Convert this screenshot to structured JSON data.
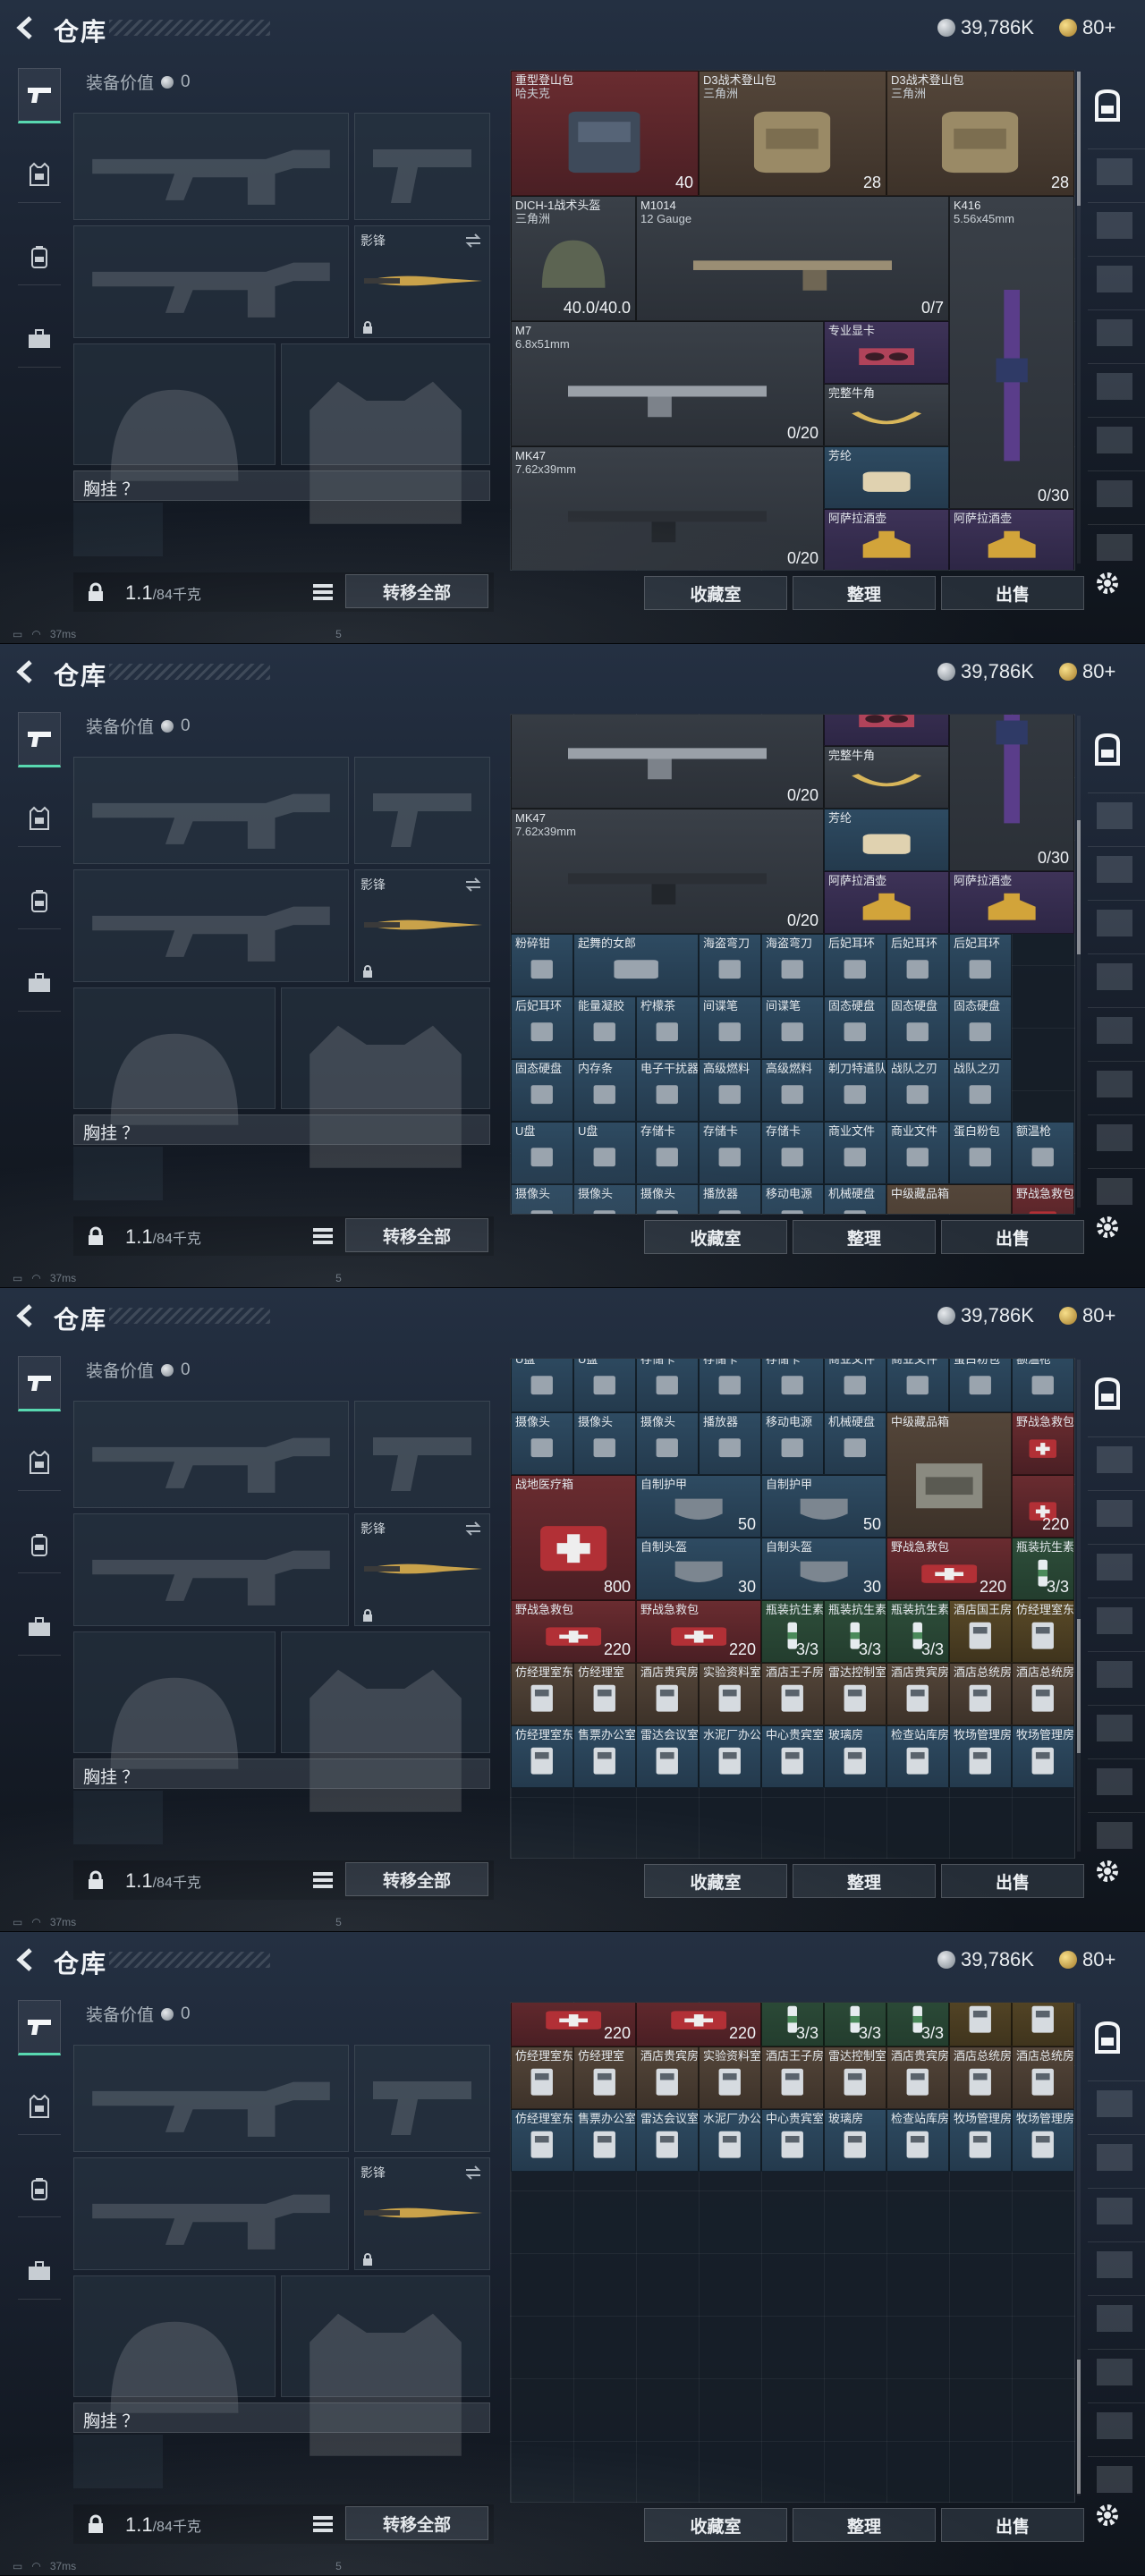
{
  "header": {
    "title": "仓库",
    "silver": "39,786K",
    "gold": "80+"
  },
  "equipment": {
    "value_label": "装备价值",
    "value": "0",
    "melee_label": "影锋",
    "chest_label": "胸挂 ？",
    "weight": "1.1",
    "capacity": "/84千克",
    "transfer_all": "转移全部"
  },
  "actions": {
    "collection": "收藏室",
    "organize": "整理",
    "sell": "出售"
  },
  "status": {
    "ping": "37ms",
    "page": "5"
  },
  "storage_items": [
    {
      "col": 0,
      "row": 0,
      "w": 3,
      "h": 2,
      "bg": "c-red",
      "name": "重型登山包",
      "sub": "哈夫克",
      "qty": "40",
      "icon": "heavy-backpack"
    },
    {
      "col": 3,
      "row": 0,
      "w": 3,
      "h": 2,
      "bg": "c-brown",
      "name": "D3战术登山包",
      "sub": "三角洲",
      "qty": "28",
      "icon": "tactical-backpack"
    },
    {
      "col": 6,
      "row": 0,
      "w": 3,
      "h": 2,
      "bg": "c-brown",
      "name": "D3战术登山包",
      "sub": "三角洲",
      "qty": "28",
      "icon": "tactical-backpack"
    },
    {
      "col": 0,
      "row": 2,
      "w": 2,
      "h": 2,
      "bg": "c-gray",
      "name": "DICH-1战术头盔",
      "sub": "三角洲",
      "qty": "40.0/40.0",
      "icon": "helmet"
    },
    {
      "col": 2,
      "row": 2,
      "w": 5,
      "h": 2,
      "bg": "c-gray",
      "name": "M1014",
      "sub": "12 Gauge",
      "qty": "0/7",
      "icon": "shotgun"
    },
    {
      "col": 7,
      "row": 2,
      "w": 2,
      "h": 5,
      "bg": "c-gray",
      "name": "K416",
      "sub": "5.56x45mm",
      "qty": "0/30",
      "icon": "rifle-k416"
    },
    {
      "col": 0,
      "row": 4,
      "w": 5,
      "h": 2,
      "bg": "c-gray",
      "name": "M7",
      "sub": "6.8x51mm",
      "qty": "0/20",
      "icon": "rifle-m7"
    },
    {
      "col": 5,
      "row": 4,
      "w": 2,
      "h": 1,
      "bg": "c-purple",
      "name": "专业显卡",
      "sub": "",
      "qty": "",
      "icon": "graphics-card"
    },
    {
      "col": 5,
      "row": 5,
      "w": 2,
      "h": 1,
      "bg": "c-gray",
      "name": "完整牛角",
      "sub": "",
      "qty": "",
      "icon": "horn"
    },
    {
      "col": 0,
      "row": 6,
      "w": 5,
      "h": 2,
      "bg": "c-gray",
      "name": "MK47",
      "sub": "7.62x39mm",
      "qty": "0/20",
      "icon": "rifle-mk47"
    },
    {
      "col": 5,
      "row": 6,
      "w": 2,
      "h": 1,
      "bg": "c-blue",
      "name": "芳纶",
      "sub": "",
      "qty": "",
      "icon": "fabric-roll"
    },
    {
      "col": 5,
      "row": 7,
      "w": 2,
      "h": 1,
      "bg": "c-purple",
      "name": "阿萨拉酒壶",
      "sub": "",
      "qty": "",
      "icon": "wine-jug"
    },
    {
      "col": 7,
      "row": 7,
      "w": 2,
      "h": 1,
      "bg": "c-purple",
      "name": "阿萨拉酒壶",
      "sub": "",
      "qty": "",
      "icon": "wine-jug"
    },
    {
      "col": 0,
      "row": 8,
      "w": 1,
      "h": 1,
      "bg": "c-blue",
      "name": "粉碎钳",
      "icon": "pliers"
    },
    {
      "col": 1,
      "row": 8,
      "w": 2,
      "h": 1,
      "bg": "c-blue",
      "name": "起舞的女郎",
      "icon": "dancer"
    },
    {
      "col": 3,
      "row": 8,
      "w": 1,
      "h": 1,
      "bg": "c-blue",
      "name": "海盗弯刀",
      "icon": "knife"
    },
    {
      "col": 4,
      "row": 8,
      "w": 1,
      "h": 1,
      "bg": "c-blue",
      "name": "海盗弯刀",
      "icon": "knife"
    },
    {
      "col": 5,
      "row": 8,
      "w": 1,
      "h": 1,
      "bg": "c-blue",
      "name": "后妃耳环",
      "icon": "earring"
    },
    {
      "col": 6,
      "row": 8,
      "w": 1,
      "h": 1,
      "bg": "c-blue",
      "name": "后妃耳环",
      "icon": "earring"
    },
    {
      "col": 7,
      "row": 8,
      "w": 1,
      "h": 1,
      "bg": "c-blue",
      "name": "后妃耳环",
      "icon": "earring"
    },
    {
      "col": 0,
      "row": 9,
      "w": 1,
      "h": 1,
      "bg": "c-blue",
      "name": "后妃耳环",
      "icon": "earring"
    },
    {
      "col": 1,
      "row": 9,
      "w": 1,
      "h": 1,
      "bg": "c-blue",
      "name": "能量凝胶",
      "icon": "gel"
    },
    {
      "col": 2,
      "row": 9,
      "w": 1,
      "h": 1,
      "bg": "c-blue",
      "name": "柠檬茶",
      "icon": "drink"
    },
    {
      "col": 3,
      "row": 9,
      "w": 1,
      "h": 1,
      "bg": "c-blue",
      "name": "间谍笔",
      "icon": "pen"
    },
    {
      "col": 4,
      "row": 9,
      "w": 1,
      "h": 1,
      "bg": "c-blue",
      "name": "间谍笔",
      "icon": "pen"
    },
    {
      "col": 5,
      "row": 9,
      "w": 1,
      "h": 1,
      "bg": "c-blue",
      "name": "固态硬盘",
      "icon": "ssd"
    },
    {
      "col": 6,
      "row": 9,
      "w": 1,
      "h": 1,
      "bg": "c-blue",
      "name": "固态硬盘",
      "icon": "ssd"
    },
    {
      "col": 7,
      "row": 9,
      "w": 1,
      "h": 1,
      "bg": "c-blue",
      "name": "固态硬盘",
      "icon": "ssd"
    },
    {
      "col": 0,
      "row": 10,
      "w": 1,
      "h": 1,
      "bg": "c-blue",
      "name": "固态硬盘",
      "icon": "ssd"
    },
    {
      "col": 1,
      "row": 10,
      "w": 1,
      "h": 1,
      "bg": "c-blue",
      "name": "内存条",
      "icon": "ram"
    },
    {
      "col": 2,
      "row": 10,
      "w": 1,
      "h": 1,
      "bg": "c-blue",
      "name": "电子干扰器",
      "icon": "jammer"
    },
    {
      "col": 3,
      "row": 10,
      "w": 1,
      "h": 1,
      "bg": "c-blue",
      "name": "高级燃料",
      "icon": "fuel"
    },
    {
      "col": 4,
      "row": 10,
      "w": 1,
      "h": 1,
      "bg": "c-blue",
      "name": "高级燃料",
      "icon": "fuel"
    },
    {
      "col": 5,
      "row": 10,
      "w": 1,
      "h": 1,
      "bg": "c-blue",
      "name": "剃刀特遣队",
      "icon": "card"
    },
    {
      "col": 6,
      "row": 10,
      "w": 1,
      "h": 1,
      "bg": "c-blue",
      "name": "战队之刃",
      "icon": "card"
    },
    {
      "col": 7,
      "row": 10,
      "w": 1,
      "h": 1,
      "bg": "c-blue",
      "name": "战队之刃",
      "icon": "card"
    },
    {
      "col": 0,
      "row": 11,
      "w": 1,
      "h": 1,
      "bg": "c-blue",
      "name": "U盘",
      "icon": "usb"
    },
    {
      "col": 1,
      "row": 11,
      "w": 1,
      "h": 1,
      "bg": "c-blue",
      "name": "U盘",
      "icon": "usb"
    },
    {
      "col": 2,
      "row": 11,
      "w": 1,
      "h": 1,
      "bg": "c-blue",
      "name": "存储卡",
      "icon": "memory-card"
    },
    {
      "col": 3,
      "row": 11,
      "w": 1,
      "h": 1,
      "bg": "c-blue",
      "name": "存储卡",
      "icon": "memory-card"
    },
    {
      "col": 4,
      "row": 11,
      "w": 1,
      "h": 1,
      "bg": "c-blue",
      "name": "存储卡",
      "icon": "memory-card"
    },
    {
      "col": 5,
      "row": 11,
      "w": 1,
      "h": 1,
      "bg": "c-blue",
      "name": "商业文件",
      "icon": "document"
    },
    {
      "col": 6,
      "row": 11,
      "w": 1,
      "h": 1,
      "bg": "c-blue",
      "name": "商业文件",
      "icon": "document"
    },
    {
      "col": 7,
      "row": 11,
      "w": 1,
      "h": 1,
      "bg": "c-blue",
      "name": "蛋白粉包",
      "icon": "pouch"
    },
    {
      "col": 8,
      "row": 11,
      "w": 1,
      "h": 1,
      "bg": "c-blue",
      "name": "额温枪",
      "icon": "thermometer"
    },
    {
      "col": 0,
      "row": 12,
      "w": 1,
      "h": 1,
      "bg": "c-blue",
      "name": "摄像头",
      "icon": "camera"
    },
    {
      "col": 1,
      "row": 12,
      "w": 1,
      "h": 1,
      "bg": "c-blue",
      "name": "摄像头",
      "icon": "camera"
    },
    {
      "col": 2,
      "row": 12,
      "w": 1,
      "h": 1,
      "bg": "c-blue",
      "name": "摄像头",
      "icon": "camera"
    },
    {
      "col": 3,
      "row": 12,
      "w": 1,
      "h": 1,
      "bg": "c-blue",
      "name": "播放器",
      "icon": "player"
    },
    {
      "col": 4,
      "row": 12,
      "w": 1,
      "h": 1,
      "bg": "c-blue",
      "name": "移动电源",
      "icon": "power-bank"
    },
    {
      "col": 5,
      "row": 12,
      "w": 1,
      "h": 1,
      "bg": "c-blue",
      "name": "机械硬盘",
      "icon": "hdd"
    },
    {
      "col": 6,
      "row": 12,
      "w": 2,
      "h": 2,
      "bg": "c-brown",
      "name": "中级藏品箱",
      "icon": "crate"
    },
    {
      "col": 8,
      "row": 12,
      "w": 1,
      "h": 1,
      "bg": "c-red",
      "name": "野战急救包",
      "icon": "first-aid"
    },
    {
      "col": 0,
      "row": 13,
      "w": 2,
      "h": 2,
      "bg": "c-red",
      "name": "战地医疗箱",
      "qty": "800",
      "icon": "medkit"
    },
    {
      "col": 2,
      "row": 13,
      "w": 2,
      "h": 1,
      "bg": "c-blue",
      "name": "自制护甲",
      "qty": "50",
      "icon": "armor-plate"
    },
    {
      "col": 4,
      "row": 13,
      "w": 2,
      "h": 1,
      "bg": "c-blue",
      "name": "自制护甲",
      "qty": "50",
      "icon": "armor-plate"
    },
    {
      "col": 8,
      "row": 13,
      "w": 1,
      "h": 1,
      "bg": "c-red",
      "name": "",
      "qty": "220",
      "icon": "first-aid"
    },
    {
      "col": 2,
      "row": 14,
      "w": 2,
      "h": 1,
      "bg": "c-blue",
      "name": "自制头盔",
      "qty": "30",
      "icon": "armor-plate"
    },
    {
      "col": 4,
      "row": 14,
      "w": 2,
      "h": 1,
      "bg": "c-blue",
      "name": "自制头盔",
      "qty": "30",
      "icon": "armor-plate"
    },
    {
      "col": 6,
      "row": 14,
      "w": 2,
      "h": 1,
      "bg": "c-red",
      "name": "野战急救包",
      "qty": "220",
      "icon": "first-aid"
    },
    {
      "col": 8,
      "row": 14,
      "w": 1,
      "h": 1,
      "bg": "c-green",
      "name": "瓶装抗生素",
      "qty": "3/3",
      "icon": "bottle"
    },
    {
      "col": 0,
      "row": 15,
      "w": 2,
      "h": 1,
      "bg": "c-red",
      "name": "野战急救包",
      "qty": "220",
      "icon": "first-aid"
    },
    {
      "col": 2,
      "row": 15,
      "w": 2,
      "h": 1,
      "bg": "c-red",
      "name": "野战急救包",
      "qty": "220",
      "icon": "first-aid"
    },
    {
      "col": 4,
      "row": 15,
      "w": 1,
      "h": 1,
      "bg": "c-green",
      "name": "瓶装抗生素",
      "qty": "3/3",
      "icon": "bottle"
    },
    {
      "col": 5,
      "row": 15,
      "w": 1,
      "h": 1,
      "bg": "c-green",
      "name": "瓶装抗生素",
      "qty": "3/3",
      "icon": "bottle"
    },
    {
      "col": 6,
      "row": 15,
      "w": 1,
      "h": 1,
      "bg": "c-green",
      "name": "瓶装抗生素",
      "qty": "3/3",
      "icon": "bottle"
    },
    {
      "col": 7,
      "row": 15,
      "w": 1,
      "h": 1,
      "bg": "c-gold",
      "name": "酒店国王房",
      "icon": "keycard"
    },
    {
      "col": 8,
      "row": 15,
      "w": 1,
      "h": 1,
      "bg": "c-gold",
      "name": "仿经理室东",
      "icon": "keycard"
    },
    {
      "col": 0,
      "row": 16,
      "w": 1,
      "h": 1,
      "bg": "c-brown",
      "name": "仿经理室东",
      "icon": "keycard"
    },
    {
      "col": 1,
      "row": 16,
      "w": 1,
      "h": 1,
      "bg": "c-brown",
      "name": "仿经理室",
      "icon": "keycard"
    },
    {
      "col": 2,
      "row": 16,
      "w": 1,
      "h": 1,
      "bg": "c-brown",
      "name": "酒店贵宾房",
      "icon": "keycard"
    },
    {
      "col": 3,
      "row": 16,
      "w": 1,
      "h": 1,
      "bg": "c-brown",
      "name": "实验资料室",
      "icon": "keycard"
    },
    {
      "col": 4,
      "row": 16,
      "w": 1,
      "h": 1,
      "bg": "c-brown",
      "name": "酒店王子房",
      "icon": "keycard"
    },
    {
      "col": 5,
      "row": 16,
      "w": 1,
      "h": 1,
      "bg": "c-brown",
      "name": "雷达控制室",
      "icon": "keycard"
    },
    {
      "col": 6,
      "row": 16,
      "w": 1,
      "h": 1,
      "bg": "c-brown",
      "name": "酒店贵宾房",
      "icon": "keycard"
    },
    {
      "col": 7,
      "row": 16,
      "w": 1,
      "h": 1,
      "bg": "c-brown",
      "name": "酒店总统房",
      "icon": "keycard"
    },
    {
      "col": 8,
      "row": 16,
      "w": 1,
      "h": 1,
      "bg": "c-brown",
      "name": "酒店总统房",
      "icon": "keycard"
    },
    {
      "col": 0,
      "row": 17,
      "w": 1,
      "h": 1,
      "bg": "c-blue",
      "name": "仿经理室东",
      "icon": "keycard"
    },
    {
      "col": 1,
      "row": 17,
      "w": 1,
      "h": 1,
      "bg": "c-blue",
      "name": "售票办公室",
      "icon": "keycard"
    },
    {
      "col": 2,
      "row": 17,
      "w": 1,
      "h": 1,
      "bg": "c-blue",
      "name": "雷达会议室",
      "icon": "keycard"
    },
    {
      "col": 3,
      "row": 17,
      "w": 1,
      "h": 1,
      "bg": "c-blue",
      "name": "水泥厂办公",
      "icon": "keycard"
    },
    {
      "col": 4,
      "row": 17,
      "w": 1,
      "h": 1,
      "bg": "c-blue",
      "name": "中心贵宾室",
      "icon": "keycard"
    },
    {
      "col": 5,
      "row": 17,
      "w": 1,
      "h": 1,
      "bg": "c-blue",
      "name": "玻璃房",
      "icon": "keycard"
    },
    {
      "col": 6,
      "row": 17,
      "w": 1,
      "h": 1,
      "bg": "c-blue",
      "name": "检查站库房",
      "icon": "keycard"
    },
    {
      "col": 7,
      "row": 17,
      "w": 1,
      "h": 1,
      "bg": "c-blue",
      "name": "牧场管理房",
      "icon": "keycard"
    },
    {
      "col": 8,
      "row": 17,
      "w": 1,
      "h": 1,
      "bg": "c-blue",
      "name": "牧场管理房",
      "icon": "keycard"
    }
  ],
  "frames": [
    {
      "scroll_row": 0
    },
    {
      "scroll_row": 4.5
    },
    {
      "scroll_row": 11.15
    },
    {
      "scroll_row": 15.3
    }
  ],
  "icons": {
    "back": "chevron-left-icon",
    "silver": "silver-coin-icon",
    "gold": "gold-coin-icon",
    "weapon_tab": "pistol-icon",
    "armor_tab": "vest-icon",
    "bag_tab": "backpack-icon",
    "case_tab": "briefcase-icon",
    "lock": "lock-icon",
    "list": "list-icon",
    "settings": "gear-icon"
  }
}
